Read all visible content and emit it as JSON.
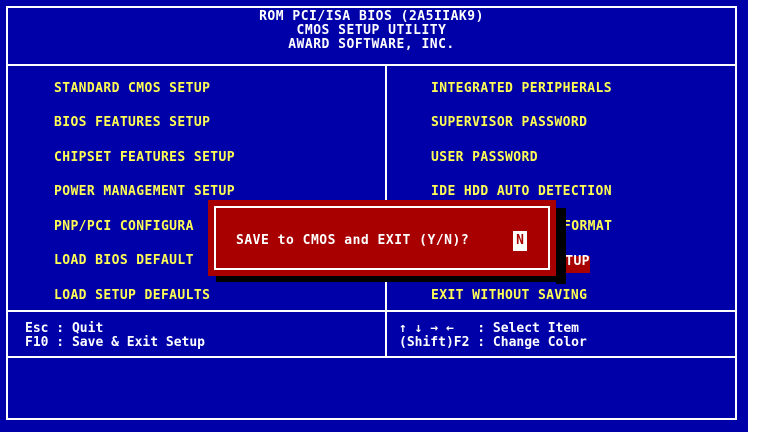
{
  "header": {
    "line1": "ROM PCI/ISA BIOS (2A5IIAK9)",
    "line2": "CMOS SETUP UTILITY",
    "line3": "AWARD SOFTWARE, INC."
  },
  "menu_left": [
    "STANDARD CMOS SETUP",
    "BIOS FEATURES SETUP",
    "CHIPSET FEATURES SETUP",
    "POWER MANAGEMENT SETUP",
    "PNP/PCI CONFIGURA",
    "LOAD BIOS DEFAULT",
    "LOAD SETUP DEFAULTS"
  ],
  "menu_right": [
    "INTEGRATED PERIPHERALS",
    "SUPERVISOR PASSWORD",
    "USER PASSWORD",
    "IDE HDD AUTO DETECTION",
    "FORMAT",
    "ETUP",
    "EXIT WITHOUT SAVING"
  ],
  "help": {
    "left1": "Esc : Quit",
    "left2": "F10 : Save & Exit Setup",
    "right1": "↑ ↓ → ←   : Select Item",
    "right2": "(Shift)F2 : Change Color"
  },
  "dialog": {
    "prompt": "SAVE to CMOS and EXIT (Y/N)?",
    "answer": "N"
  },
  "colors": {
    "background": "#0000a8",
    "menu_text": "#ffff54",
    "dialog": "#a80000"
  }
}
